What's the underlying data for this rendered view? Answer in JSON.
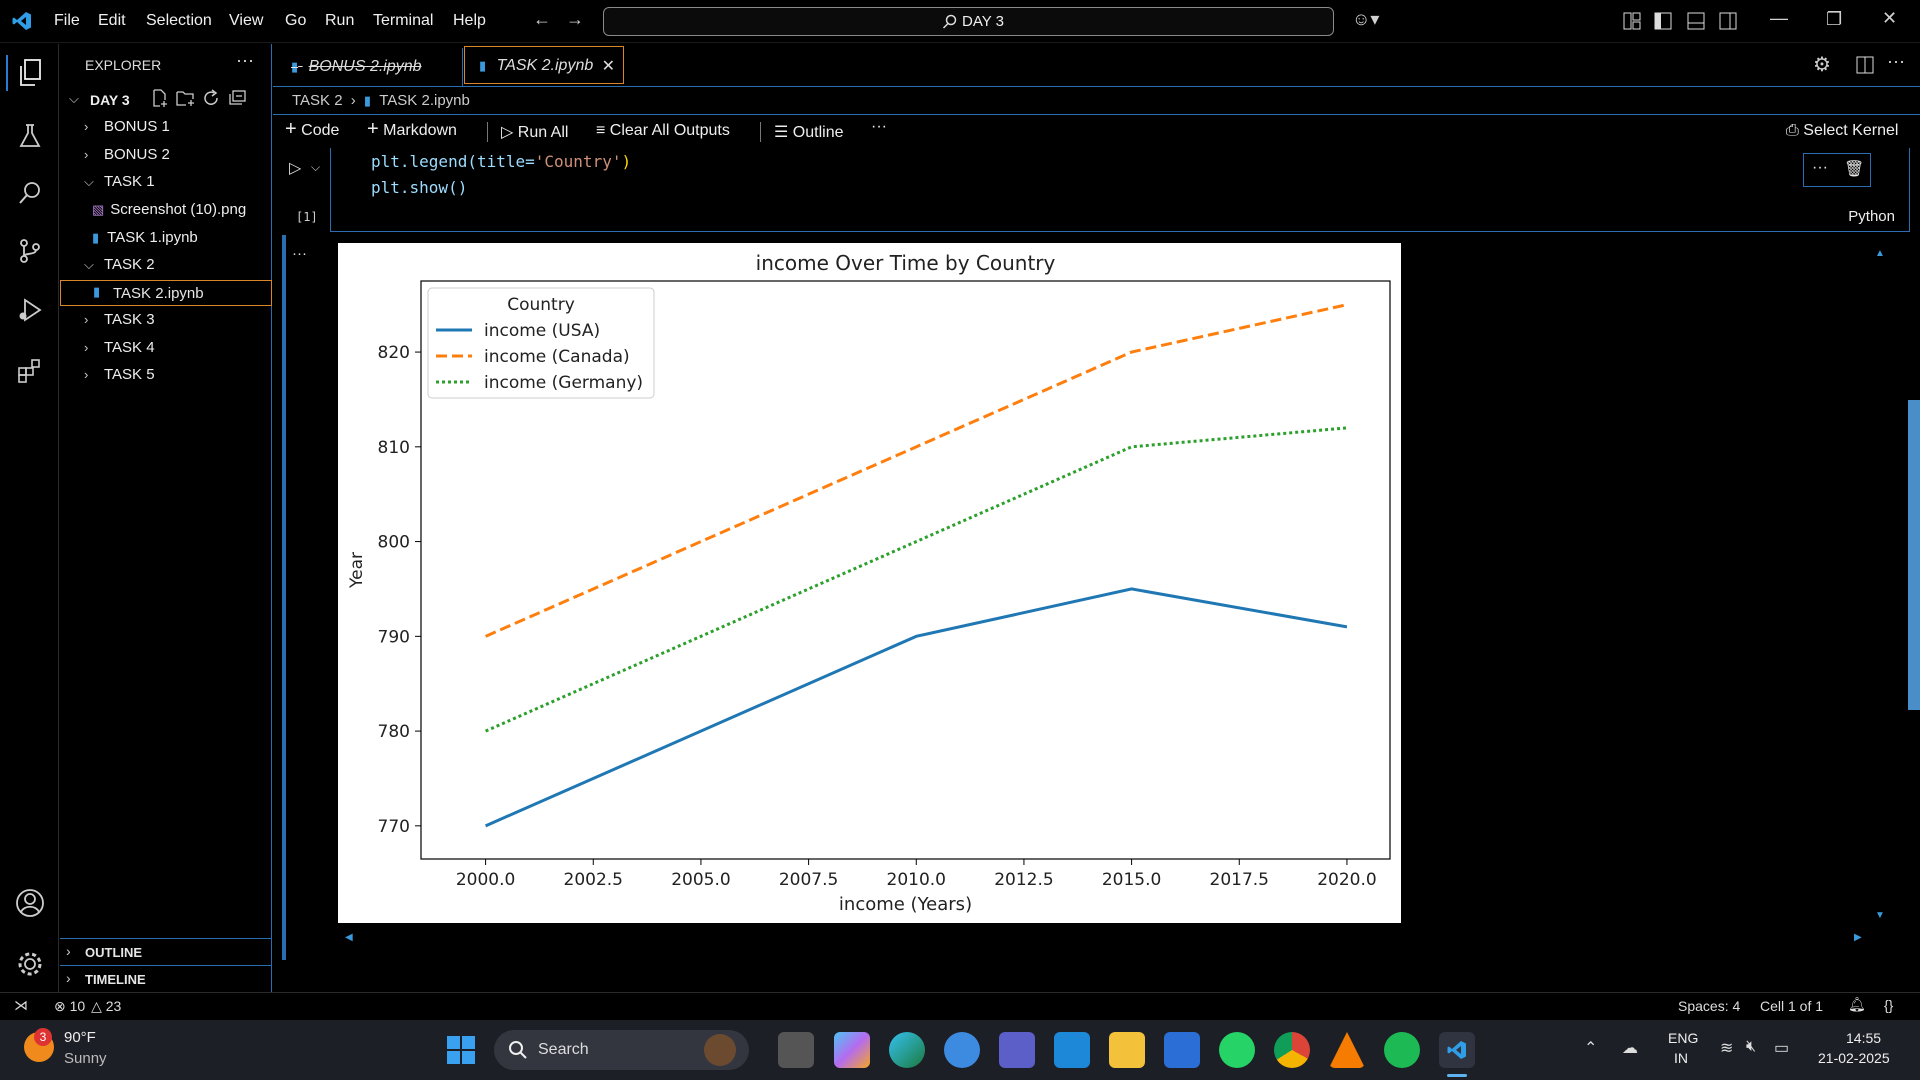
{
  "titlebar": {
    "menus": [
      "File",
      "Edit",
      "Selection",
      "View",
      "Go",
      "Run",
      "Terminal",
      "Help"
    ],
    "search_text": "DAY 3"
  },
  "explorer": {
    "title": "EXPLORER",
    "root": "DAY 3",
    "items": [
      {
        "label": "BONUS 1",
        "type": "folder",
        "open": false
      },
      {
        "label": "BONUS 2",
        "type": "folder",
        "open": false
      },
      {
        "label": "TASK 1",
        "type": "folder",
        "open": true
      },
      {
        "label": "Screenshot (10).png",
        "type": "image"
      },
      {
        "label": "TASK 1.ipynb",
        "type": "notebook"
      },
      {
        "label": "TASK 2",
        "type": "folder",
        "open": true
      },
      {
        "label": "TASK 2.ipynb",
        "type": "notebook",
        "selected": true
      },
      {
        "label": "TASK 3",
        "type": "folder",
        "open": false
      },
      {
        "label": "TASK 4",
        "type": "folder",
        "open": false
      },
      {
        "label": "TASK 5",
        "type": "folder",
        "open": false
      }
    ],
    "outline": "OUTLINE",
    "timeline": "TIMELINE"
  },
  "tabs": [
    {
      "label": "BONUS 2.ipynb",
      "active": false
    },
    {
      "label": "TASK 2.ipynb",
      "active": true
    }
  ],
  "breadcrumb": {
    "folder": "TASK 2",
    "file": "TASK 2.ipynb"
  },
  "toolbar": {
    "code": "Code",
    "markdown": "Markdown",
    "run_all": "Run All",
    "clear_all": "Clear All Outputs",
    "outline": "Outline",
    "select_kernel": "Select Kernel"
  },
  "cell": {
    "line1_fn": "plt.legend(",
    "line1_kw": "title=",
    "line1_str": "'Country'",
    "line1_end": ")",
    "line2": "plt.show()",
    "exec_count": "[1]",
    "language": "Python"
  },
  "chart_data": {
    "type": "line",
    "title": "income Over Time by Country",
    "xlabel": "income (Years)",
    "ylabel": "Year",
    "x": [
      2000,
      2010,
      2015,
      2020
    ],
    "xlim": [
      1998.5,
      2021.0
    ],
    "ylim": [
      766.5,
      827.5
    ],
    "xticks": [
      "2000.0",
      "2002.5",
      "2005.0",
      "2007.5",
      "2010.0",
      "2012.5",
      "2015.0",
      "2017.5",
      "2020.0"
    ],
    "yticks": [
      "770",
      "780",
      "790",
      "800",
      "810",
      "820"
    ],
    "legend_title": "Country",
    "legend_placement": "top-left",
    "grid": false,
    "series": [
      {
        "name": "income (USA)",
        "values": [
          770,
          790,
          795,
          791
        ],
        "color": "#1f77b4",
        "style": "solid"
      },
      {
        "name": "income (Canada)",
        "values": [
          790,
          810,
          820,
          825
        ],
        "color": "#ff7f0e",
        "style": "dashed"
      },
      {
        "name": "income (Germany)",
        "values": [
          780,
          800,
          810,
          812
        ],
        "color": "#2ca02c",
        "style": "dotted"
      }
    ]
  },
  "statusbar": {
    "errors": "10",
    "warnings": "23",
    "spaces": "Spaces: 4",
    "cell": "Cell 1 of 1"
  },
  "taskbar": {
    "weather_temp": "90°F",
    "weather_desc": "Sunny",
    "weather_badge": "3",
    "search": "Search",
    "lang_top": "ENG",
    "lang_bottom": "IN",
    "time": "14:55",
    "date": "21-02-2025"
  }
}
